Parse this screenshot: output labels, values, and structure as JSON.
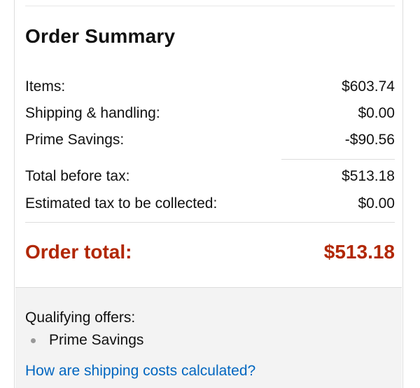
{
  "order_summary": {
    "title": "Order Summary",
    "lines": [
      {
        "label": "Items:",
        "value": "$603.74"
      },
      {
        "label": "Shipping & handling:",
        "value": "$0.00"
      },
      {
        "label": "Prime Savings:",
        "value": "-$90.56"
      },
      {
        "label": "Total before tax:",
        "value": "$513.18"
      },
      {
        "label": "Estimated tax to be collected:",
        "value": "$0.00"
      }
    ],
    "total": {
      "label": "Order total:",
      "value": "$513.18"
    }
  },
  "offers": {
    "label": "Qualifying offers:",
    "items": [
      "Prime Savings"
    ]
  },
  "shipping_link": "How are shipping costs calculated?",
  "colors": {
    "total": "#b12704",
    "link": "#0066c0",
    "footer_bg": "#f3f3f3"
  }
}
